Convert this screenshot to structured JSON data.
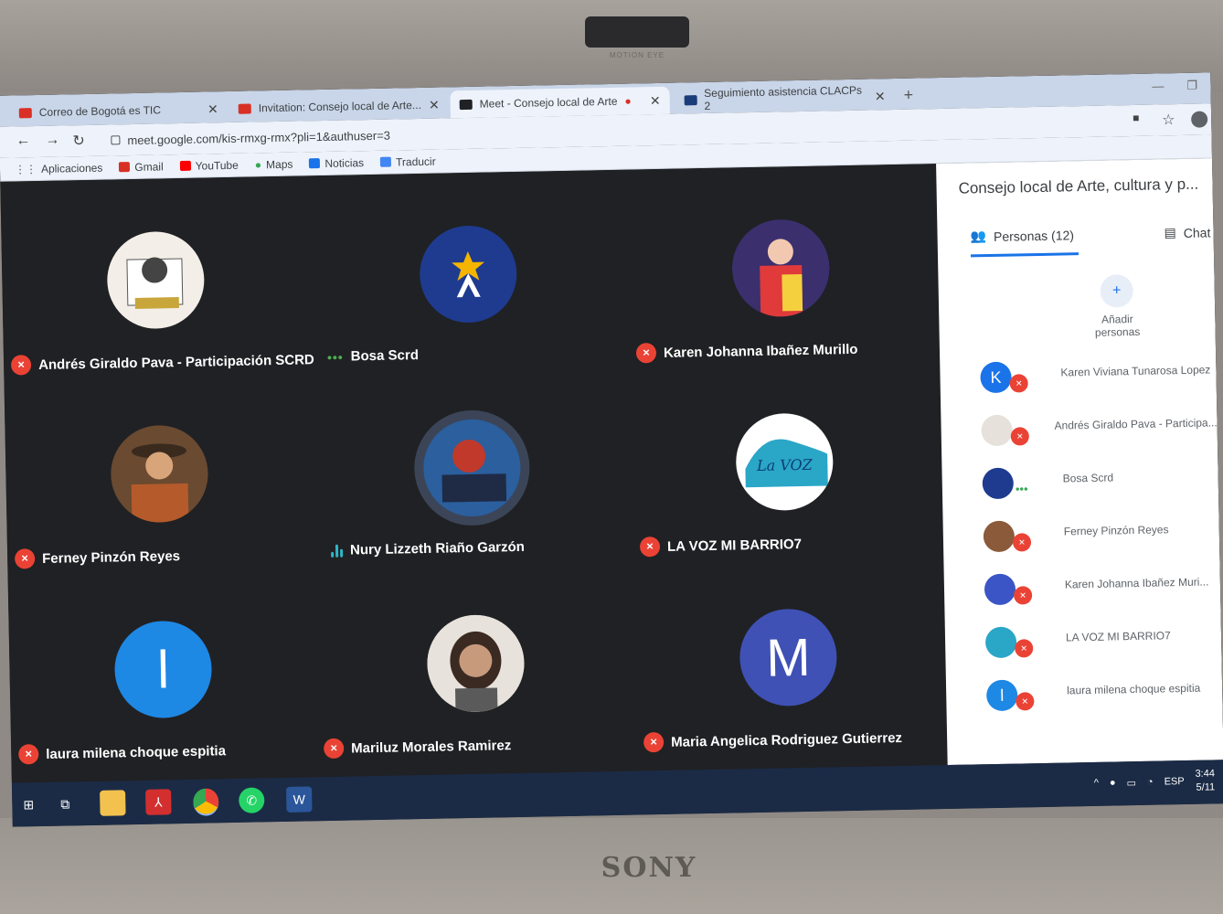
{
  "device": {
    "camera_label": "MOTION EYE",
    "brand": "SONY"
  },
  "browser": {
    "tabs": [
      {
        "label": "Correo de Bogotá es TIC",
        "active": false
      },
      {
        "label": "Invitation: Consejo local de Arte...",
        "active": false
      },
      {
        "label": "Meet - Consejo local de Arte",
        "active": true
      },
      {
        "label": "Seguimiento asistencia CLACPs 2",
        "active": false
      }
    ],
    "url": "meet.google.com/kis-rmxg-rmx?pli=1&authuser=3",
    "bookmarks": [
      "Aplicaciones",
      "Gmail",
      "YouTube",
      "Maps",
      "Noticias",
      "Traducir"
    ]
  },
  "meeting": {
    "participants_grid": [
      {
        "name": "Andrés Giraldo Pava - Participación SCRD",
        "status": "muted",
        "avatar": "photo",
        "color": "#f3efe8"
      },
      {
        "name": "Bosa Scrd",
        "status": "dots",
        "avatar": "logo",
        "color": "#1e3b8f"
      },
      {
        "name": "Karen Johanna Ibañez Murillo",
        "status": "muted",
        "avatar": "photo",
        "color": "#3c55c6"
      },
      {
        "name": "Ferney Pinzón Reyes",
        "status": "muted",
        "avatar": "photo",
        "color": "#8a5a3a"
      },
      {
        "name": "Nury Lizzeth Riaño Garzón",
        "status": "speaking",
        "avatar": "photo",
        "color": "#2b5f9e"
      },
      {
        "name": "LA VOZ MI BARRIO7",
        "status": "muted",
        "avatar": "logo",
        "color": "#2aa6c7"
      },
      {
        "name": "laura milena choque espitia",
        "status": "muted",
        "avatar": "letter",
        "letter": "l",
        "color": "#1e88e5"
      },
      {
        "name": "Mariluz Morales Ramirez",
        "status": "muted",
        "avatar": "photo",
        "color": "#d9cfc6"
      },
      {
        "name": "Maria Angelica Rodriguez Gutierrez",
        "status": "muted",
        "avatar": "letter",
        "letter": "M",
        "color": "#3f51b5"
      }
    ]
  },
  "panel": {
    "title": "Consejo local de Arte, cultura y p...",
    "people_tab": "Personas (12)",
    "chat_tab": "Chat",
    "add_people": "Añadir personas",
    "people": [
      {
        "name": "Karen Viviana Tunarosa Lopez",
        "letter": "K",
        "color": "#1a73e8",
        "status": "muted"
      },
      {
        "name": "Andrés Giraldo Pava - Participa...",
        "letter": "",
        "color": "#e6e1da",
        "status": "muted"
      },
      {
        "name": "Bosa Scrd",
        "letter": "",
        "color": "#1e3b8f",
        "status": "dots"
      },
      {
        "name": "Ferney Pinzón Reyes",
        "letter": "",
        "color": "#8a5a3a",
        "status": "muted"
      },
      {
        "name": "Karen Johanna Ibañez Muri...",
        "letter": "",
        "color": "#3c55c6",
        "status": "muted"
      },
      {
        "name": "LA VOZ MI BARRIO7",
        "letter": "",
        "color": "#2aa6c7",
        "status": "muted"
      },
      {
        "name": "laura milena choque espitia",
        "letter": "l",
        "color": "#1e88e5",
        "status": "muted"
      }
    ]
  },
  "taskbar": {
    "lang": "ESP",
    "time": "3:44",
    "date": "5/11"
  }
}
